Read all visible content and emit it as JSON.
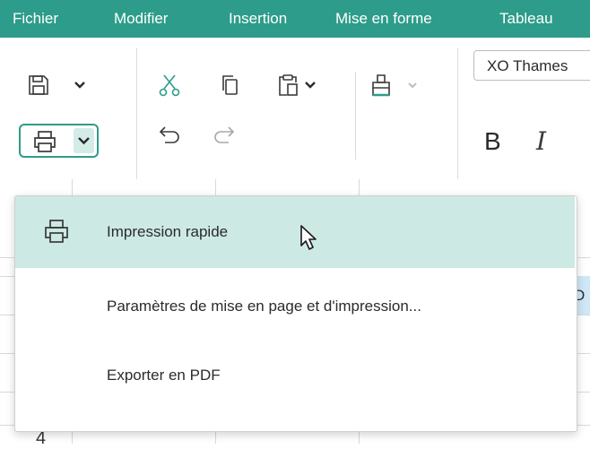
{
  "menubar": {
    "items": [
      "Fichier",
      "Modifier",
      "Insertion",
      "Mise en forme",
      "Tableau"
    ]
  },
  "toolbar": {
    "font_name": "XO Thames",
    "bold_label": "B",
    "italic_label": "I",
    "icons": [
      "save-icon",
      "print-icon",
      "cut-icon",
      "copy-icon",
      "paste-icon",
      "format-painter-icon",
      "undo-icon",
      "redo-icon"
    ]
  },
  "print_menu": {
    "items": [
      {
        "label": "Impression rapide",
        "icon": "printer-icon",
        "highlighted": true
      },
      {
        "label": "Paramètres de mise en page et d'impression...",
        "icon": "",
        "highlighted": false
      },
      {
        "label": "Exporter en PDF",
        "icon": "",
        "highlighted": false
      }
    ]
  },
  "sheet": {
    "partial_cell_text": "D",
    "row_number": "4"
  },
  "colors": {
    "accent": "#2d9c8a",
    "highlight": "#cde9e4",
    "selected_cell": "#cfe7f6"
  }
}
